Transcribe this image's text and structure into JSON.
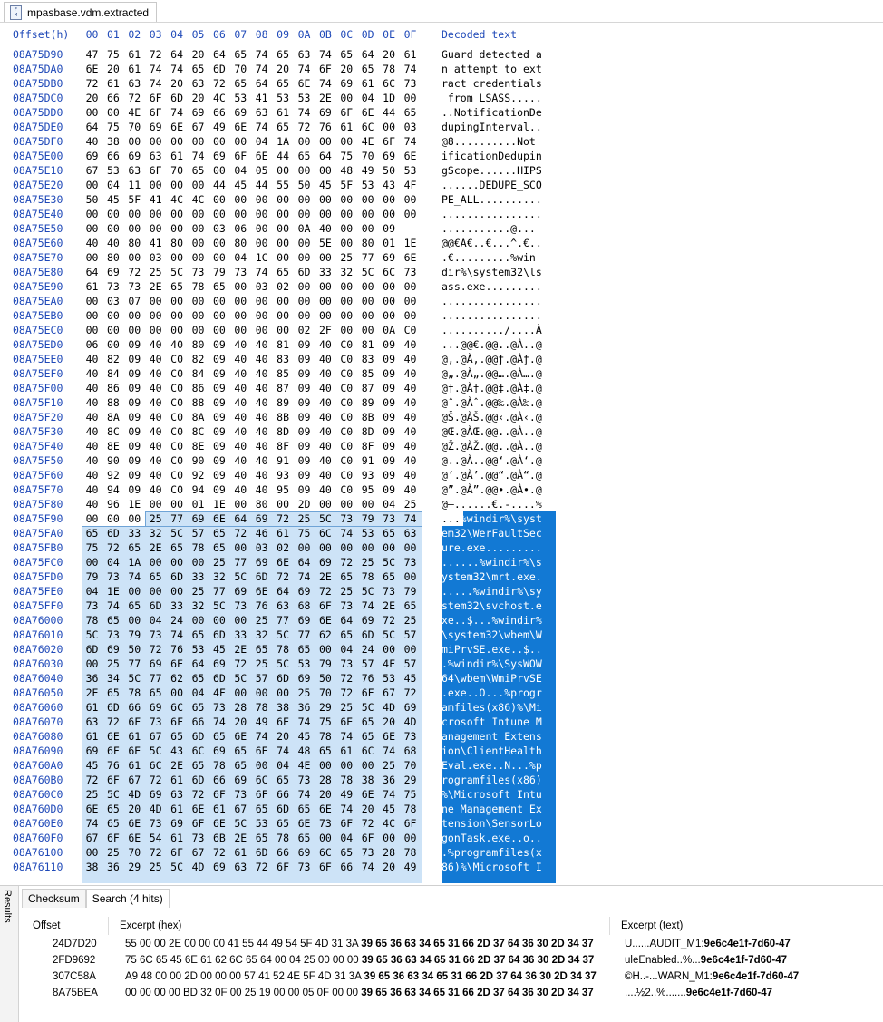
{
  "tab": {
    "title": "mpasbase.vdm.extracted",
    "icon": "file-icon"
  },
  "hex_header": {
    "offset": "Offset(h)",
    "columns": [
      "00",
      "01",
      "02",
      "03",
      "04",
      "05",
      "06",
      "07",
      "08",
      "09",
      "0A",
      "0B",
      "0C",
      "0D",
      "0E",
      "0F"
    ],
    "decoded": "Decoded text"
  },
  "rows": [
    {
      "offset": "08A75D90",
      "bytes": "47 75 61 72 64 20 64 65 74 65 63 74 65 64 20 61",
      "text": "Guard detected a"
    },
    {
      "offset": "08A75DA0",
      "bytes": "6E 20 61 74 74 65 6D 70 74 20 74 6F 20 65 78 74",
      "text": "n attempt to ext"
    },
    {
      "offset": "08A75DB0",
      "bytes": "72 61 63 74 20 63 72 65 64 65 6E 74 69 61 6C 73",
      "text": "ract credentials"
    },
    {
      "offset": "08A75DC0",
      "bytes": "20 66 72 6F 6D 20 4C 53 41 53 53 2E 00 04 1D 00",
      "text": " from LSASS....."
    },
    {
      "offset": "08A75DD0",
      "bytes": "00 00 4E 6F 74 69 66 69 63 61 74 69 6F 6E 44 65",
      "text": "..NotificationDe"
    },
    {
      "offset": "08A75DE0",
      "bytes": "64 75 70 69 6E 67 49 6E 74 65 72 76 61 6C 00 03",
      "text": "dupingInterval.."
    },
    {
      "offset": "08A75DF0",
      "bytes": "40 38 00 00 00 00 00 00 04 1A 00 00 00 4E 6F 74",
      "text": "@8..........Not"
    },
    {
      "offset": "08A75E00",
      "bytes": "69 66 69 63 61 74 69 6F 6E 44 65 64 75 70 69 6E",
      "text": "ificationDedupin"
    },
    {
      "offset": "08A75E10",
      "bytes": "67 53 63 6F 70 65 00 04 05 00 00 00 48 49 50 53",
      "text": "gScope......HIPS"
    },
    {
      "offset": "08A75E20",
      "bytes": "00 04 11 00 00 00 44 45 44 55 50 45 5F 53 43 4F",
      "text": "......DEDUPE_SCO"
    },
    {
      "offset": "08A75E30",
      "bytes": "50 45 5F 41 4C 4C 00 00 00 00 00 00 00 00 00 00",
      "text": "PE_ALL.........."
    },
    {
      "offset": "08A75E40",
      "bytes": "00 00 00 00 00 00 00 00 00 00 00 00 00 00 00 00",
      "text": "................"
    },
    {
      "offset": "08A75E50",
      "bytes": "00 00 00 00 00 00 03 06 00 00 0A 40 00 00 09",
      "text": "...........@..."
    },
    {
      "offset": "08A75E60",
      "bytes": "40 40 80 41 80 00 00 80 00 00 00 5E 00 80 01 1E",
      "text": "@@€A€..€...^.€.."
    },
    {
      "offset": "08A75E70",
      "bytes": "00 80 00 03 00 00 00 04 1C 00 00 00 25 77 69 6E",
      "text": ".€.........%win"
    },
    {
      "offset": "08A75E80",
      "bytes": "64 69 72 25 5C 73 79 73 74 65 6D 33 32 5C 6C 73",
      "text": "dir%\\system32\\ls"
    },
    {
      "offset": "08A75E90",
      "bytes": "61 73 73 2E 65 78 65 00 03 02 00 00 00 00 00 00",
      "text": "ass.exe........."
    },
    {
      "offset": "08A75EA0",
      "bytes": "00 03 07 00 00 00 00 00 00 00 00 00 00 00 00 00",
      "text": "................"
    },
    {
      "offset": "08A75EB0",
      "bytes": "00 00 00 00 00 00 00 00 00 00 00 00 00 00 00 00",
      "text": "................"
    },
    {
      "offset": "08A75EC0",
      "bytes": "00 00 00 00 00 00 00 00 00 00 02 2F 00 00 0A C0",
      "text": "........../....À"
    },
    {
      "offset": "08A75ED0",
      "bytes": "06 00 09 40 40 80 09 40 40 81 09 40 C0 81 09 40",
      "text": "...@@€.@@..@À..@"
    },
    {
      "offset": "08A75EE0",
      "bytes": "40 82 09 40 C0 82 09 40 40 83 09 40 C0 83 09 40",
      "text": "@‚.@À‚.@@ƒ.@Àƒ.@"
    },
    {
      "offset": "08A75EF0",
      "bytes": "40 84 09 40 C0 84 09 40 40 85 09 40 C0 85 09 40",
      "text": "@„.@À„.@@….@À….@"
    },
    {
      "offset": "08A75F00",
      "bytes": "40 86 09 40 C0 86 09 40 40 87 09 40 C0 87 09 40",
      "text": "@†.@À†.@@‡.@À‡.@"
    },
    {
      "offset": "08A75F10",
      "bytes": "40 88 09 40 C0 88 09 40 40 89 09 40 C0 89 09 40",
      "text": "@ˆ.@Àˆ.@@‰.@À‰.@"
    },
    {
      "offset": "08A75F20",
      "bytes": "40 8A 09 40 C0 8A 09 40 40 8B 09 40 C0 8B 09 40",
      "text": "@Š.@ÀŠ.@@‹.@À‹.@"
    },
    {
      "offset": "08A75F30",
      "bytes": "40 8C 09 40 C0 8C 09 40 40 8D 09 40 C0 8D 09 40",
      "text": "@Œ.@ÀŒ.@@..@À..@"
    },
    {
      "offset": "08A75F40",
      "bytes": "40 8E 09 40 C0 8E 09 40 40 8F 09 40 C0 8F 09 40",
      "text": "@Ž.@ÀŽ.@@..@À..@"
    },
    {
      "offset": "08A75F50",
      "bytes": "40 90 09 40 C0 90 09 40 40 91 09 40 C0 91 09 40",
      "text": "@..@À..@@‘.@À‘.@"
    },
    {
      "offset": "08A75F60",
      "bytes": "40 92 09 40 C0 92 09 40 40 93 09 40 C0 93 09 40",
      "text": "@’.@À’.@@“.@À“.@"
    },
    {
      "offset": "08A75F70",
      "bytes": "40 94 09 40 C0 94 09 40 40 95 09 40 C0 95 09 40",
      "text": "@”.@À”.@@•.@À•.@"
    },
    {
      "offset": "08A75F80",
      "bytes": "40 96 1E 00 00 01 1E 00 80 00 2D 00 00 00 04 25",
      "text": "@–......€.-....%"
    },
    {
      "offset": "08A75F90",
      "bytes": "00 00 00 25 77 69 6E 64 69 72 25 5C 73 79 73 74",
      "text": "...%windir%\\syst"
    },
    {
      "offset": "08A75FA0",
      "bytes": "65 6D 33 32 5C 57 65 72 46 61 75 6C 74 53 65 63",
      "text": "em32\\WerFaultSec"
    },
    {
      "offset": "08A75FB0",
      "bytes": "75 72 65 2E 65 78 65 00 03 02 00 00 00 00 00 00",
      "text": "ure.exe........."
    },
    {
      "offset": "08A75FC0",
      "bytes": "00 04 1A 00 00 00 25 77 69 6E 64 69 72 25 5C 73",
      "text": "......%windir%\\s"
    },
    {
      "offset": "08A75FD0",
      "bytes": "79 73 74 65 6D 33 32 5C 6D 72 74 2E 65 78 65 00",
      "text": "ystem32\\mrt.exe."
    },
    {
      "offset": "08A75FE0",
      "bytes": "04 1E 00 00 00 25 77 69 6E 64 69 72 25 5C 73 79",
      "text": ".....%windir%\\sy"
    },
    {
      "offset": "08A75FF0",
      "bytes": "73 74 65 6D 33 32 5C 73 76 63 68 6F 73 74 2E 65",
      "text": "stem32\\svchost.e"
    },
    {
      "offset": "08A76000",
      "bytes": "78 65 00 04 24 00 00 00 25 77 69 6E 64 69 72 25",
      "text": "xe..$...%windir%"
    },
    {
      "offset": "08A76010",
      "bytes": "5C 73 79 73 74 65 6D 33 32 5C 77 62 65 6D 5C 57",
      "text": "\\system32\\wbem\\W"
    },
    {
      "offset": "08A76020",
      "bytes": "6D 69 50 72 76 53 45 2E 65 78 65 00 04 24 00 00",
      "text": "miPrvSE.exe..$.."
    },
    {
      "offset": "08A76030",
      "bytes": "00 25 77 69 6E 64 69 72 25 5C 53 79 73 57 4F 57",
      "text": ".%windir%\\SysWOW"
    },
    {
      "offset": "08A76040",
      "bytes": "36 34 5C 77 62 65 6D 5C 57 6D 69 50 72 76 53 45",
      "text": "64\\wbem\\WmiPrvSE"
    },
    {
      "offset": "08A76050",
      "bytes": "2E 65 78 65 00 04 4F 00 00 00 25 70 72 6F 67 72",
      "text": ".exe..O...%progr"
    },
    {
      "offset": "08A76060",
      "bytes": "61 6D 66 69 6C 65 73 28 78 38 36 29 25 5C 4D 69",
      "text": "amfiles(x86)%\\Mi"
    },
    {
      "offset": "08A76070",
      "bytes": "63 72 6F 73 6F 66 74 20 49 6E 74 75 6E 65 20 4D",
      "text": "crosoft Intune M"
    },
    {
      "offset": "08A76080",
      "bytes": "61 6E 61 67 65 6D 65 6E 74 20 45 78 74 65 6E 73",
      "text": "anagement Extens"
    },
    {
      "offset": "08A76090",
      "bytes": "69 6F 6E 5C 43 6C 69 65 6E 74 48 65 61 6C 74 68",
      "text": "ion\\ClientHealth"
    },
    {
      "offset": "08A760A0",
      "bytes": "45 76 61 6C 2E 65 78 65 00 04 4E 00 00 00 25 70",
      "text": "Eval.exe..N...%p"
    },
    {
      "offset": "08A760B0",
      "bytes": "72 6F 67 72 61 6D 66 69 6C 65 73 28 78 38 36 29",
      "text": "rogramfiles(x86)"
    },
    {
      "offset": "08A760C0",
      "bytes": "25 5C 4D 69 63 72 6F 73 6F 66 74 20 49 6E 74 75",
      "text": "%\\Microsoft Intu"
    },
    {
      "offset": "08A760D0",
      "bytes": "6E 65 20 4D 61 6E 61 67 65 6D 65 6E 74 20 45 78",
      "text": "ne Management Ex"
    },
    {
      "offset": "08A760E0",
      "bytes": "74 65 6E 73 69 6F 6E 5C 53 65 6E 73 6F 72 4C 6F",
      "text": "tension\\SensorLo"
    },
    {
      "offset": "08A760F0",
      "bytes": "67 6F 6E 54 61 73 6B 2E 65 78 65 00 04 6F 00 00",
      "text": "gonTask.exe..o.."
    },
    {
      "offset": "08A76100",
      "bytes": "00 25 70 72 6F 67 72 61 6D 66 69 6C 65 73 28 78",
      "text": ".%programfiles(x"
    },
    {
      "offset": "08A76110",
      "bytes": "38 36 29 25 5C 4D 69 63 72 6F 73 6F 66 74 20 49",
      "text": "86)%\\Microsoft I"
    }
  ],
  "results": {
    "side_label": "Results",
    "tabs": [
      {
        "label": "Checksum"
      },
      {
        "label": "Search (4 hits)"
      }
    ],
    "columns": [
      "Offset",
      "Excerpt (hex)",
      "Excerpt (text)"
    ],
    "rows": [
      {
        "offset": "24D7D20",
        "hex_pre": "55 00 00 2E 00 00 00 41 55 44 49 54 5F 4D 31 3A ",
        "hex_hit": "39 65 36 63 34 65 31 66 2D 37 64 36 30 2D 34 37",
        "text_pre": "U......AUDIT_M1:",
        "text_hit": "9e6c4e1f-7d60-47"
      },
      {
        "offset": "2FD9692",
        "hex_pre": "75 6C 65 45 6E 61 62 6C 65 64 00 04 25 00 00 00 ",
        "hex_hit": "39 65 36 63 34 65 31 66 2D 37 64 36 30 2D 34 37",
        "text_pre": "uleEnabled..%...",
        "text_hit": "9e6c4e1f-7d60-47"
      },
      {
        "offset": "307C58A",
        "hex_pre": "A9 48 00 00 2D 00 00 00 57 41 52 4E 5F 4D 31 3A ",
        "hex_hit": "39 65 36 63 34 65 31 66 2D 37 64 36 30 2D 34 37",
        "text_pre": "©H..-...WARN_M1:",
        "text_hit": "9e6c4e1f-7d60-47"
      },
      {
        "offset": "8A75BEA",
        "hex_pre": "00 00 00 00 BD 32 0F 00 25 19 00 00 05 0F 00 00 ",
        "hex_hit": "39 65 36 63 34 65 31 66 2D 37 64 36 30 2D 34 37",
        "text_pre": "....½2..%.......",
        "text_hit": "9e6c4e1f-7d60-47"
      }
    ]
  }
}
